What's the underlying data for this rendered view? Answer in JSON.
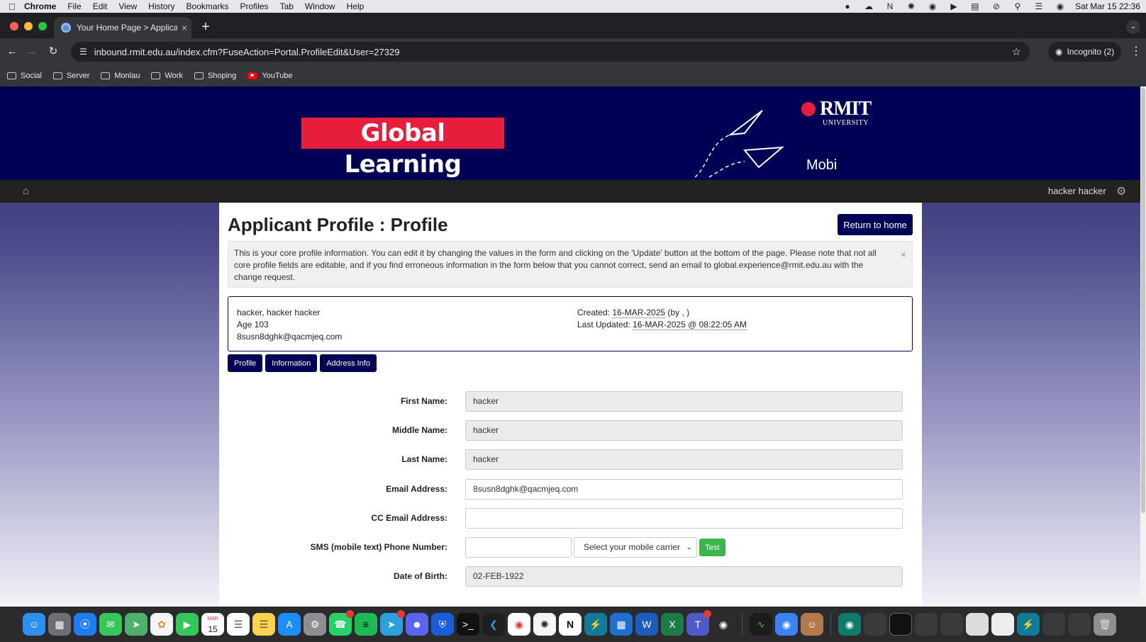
{
  "menubar": {
    "items": [
      "Chrome",
      "File",
      "Edit",
      "View",
      "History",
      "Bookmarks",
      "Profiles",
      "Tab",
      "Window",
      "Help"
    ],
    "datetime": "Sat Mar 15  22:36"
  },
  "browser": {
    "tab_title": "Your Home Page > Applicant",
    "url": "inbound.rmit.edu.au/index.cfm?FuseAction=Portal.ProfileEdit&User=27329",
    "incognito": "Incognito (2)",
    "bookmarks": [
      {
        "label": "Social",
        "icon": "folder-icon"
      },
      {
        "label": "Server",
        "icon": "folder-icon"
      },
      {
        "label": "Monlau",
        "icon": "folder-icon"
      },
      {
        "label": "Work",
        "icon": "folder-icon"
      },
      {
        "label": "Shoping",
        "icon": "folder-icon"
      },
      {
        "label": "YouTube",
        "icon": "youtube-icon"
      }
    ]
  },
  "banner": {
    "logo_text": "Global Learning",
    "rmit_name": "RMIT",
    "rmit_sub": "UNIVERSITY",
    "mobi": "Mobi",
    "colors": {
      "navy": "#000054",
      "red": "#e61e3c"
    }
  },
  "subnav": {
    "user": "hacker hacker"
  },
  "page": {
    "title": "Applicant Profile : Profile",
    "return_button": "Return to home",
    "notice": "This is your core profile information. You can edit it by changing the values in the form and clicking on the 'Update' button at the bottom of the page. Please note that not all core profile fields are editable, and if you find erroneous information in the form below that you cannot correct, send an email to global.experience@rmit.edu.au with the change request.",
    "card": {
      "name": "hacker, hacker hacker",
      "age": "Age 103",
      "email": "8susn8dghk@qacmjeq.com",
      "created_label": "Created:",
      "created_date": "16-MAR-2025",
      "created_by": "(by , )",
      "updated_label": "Last Updated:",
      "updated_date": "16-MAR-2025 @ 08:22:05 AM"
    },
    "tabs": [
      "Profile",
      "Information",
      "Address Info"
    ],
    "form": {
      "first_name": {
        "label": "First Name:",
        "value": "hacker"
      },
      "middle_name": {
        "label": "Middle Name:",
        "value": "hacker"
      },
      "last_name": {
        "label": "Last Name:",
        "value": "hacker"
      },
      "email": {
        "label": "Email Address:",
        "value": "8susn8dghk@qacmjeq.com"
      },
      "cc_email": {
        "label": "CC Email Address:",
        "value": ""
      },
      "sms": {
        "label": "SMS (mobile text) Phone Number:",
        "value": "",
        "carrier_selected": "Select your mobile carrier",
        "test_label": "Test"
      },
      "dob": {
        "label": "Date of Birth:",
        "value": "02-FEB-1922"
      }
    }
  },
  "dock": {
    "apps": [
      "finder",
      "launchpad",
      "safari",
      "messages",
      "maps",
      "photos",
      "facetime",
      "calendar",
      "reminders",
      "notes",
      "app-store",
      "system-settings",
      "whatsapp",
      "spotify",
      "telegram",
      "discord",
      "bitwarden",
      "terminal",
      "vscode",
      "chrome",
      "chatgpt",
      "notion",
      "electric",
      "windows-app",
      "word",
      "excel",
      "teams",
      "obs"
    ],
    "calendar_month": "MAR",
    "calendar_day": "15"
  }
}
